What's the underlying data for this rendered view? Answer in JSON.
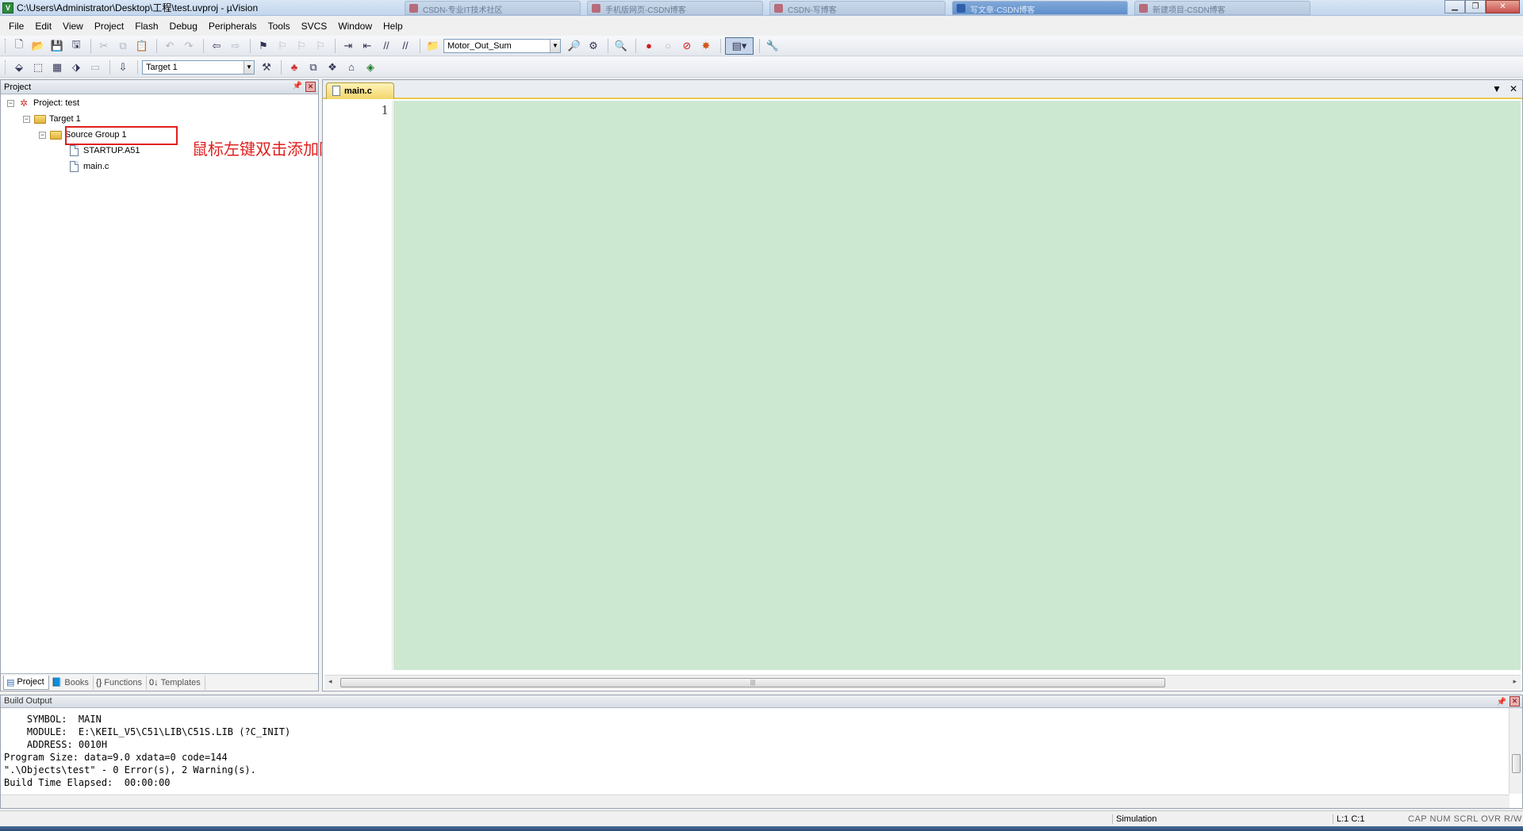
{
  "window": {
    "title": "C:\\Users\\Administrator\\Desktop\\工程\\test.uvproj - µVision",
    "background_tabs": [
      "CSDN-专业IT技术社区",
      "手机版网页-CSDN博客",
      "CSDN-写博客",
      "写文章-CSDN博客",
      "新建项目-CSDN博客"
    ]
  },
  "menu": [
    "File",
    "Edit",
    "View",
    "Project",
    "Flash",
    "Debug",
    "Peripherals",
    "Tools",
    "SVCS",
    "Window",
    "Help"
  ],
  "toolbar": {
    "function_combo": "Motor_Out_Sum",
    "target_combo": "Target 1"
  },
  "project_panel": {
    "title": "Project",
    "tree": {
      "project": "Project: test",
      "target": "Target 1",
      "group": "Source Group 1",
      "files": [
        "STARTUP.A51",
        "main.c"
      ]
    },
    "annotation": "鼠标左键双击添加刚新建的main.c",
    "tabs": [
      "Project",
      "Books",
      "Functions",
      "Templates"
    ]
  },
  "editor": {
    "tab": "main.c",
    "line_numbers": [
      "1"
    ],
    "code_bg": "#cde8d0"
  },
  "build_output": {
    "title": "Build Output",
    "lines": [
      "    SYMBOL:  MAIN",
      "    MODULE:  E:\\KEIL_V5\\C51\\LIB\\C51S.LIB (?C_INIT)",
      "    ADDRESS: 0010H",
      "Program Size: data=9.0 xdata=0 code=144",
      "\".\\Objects\\test\" - 0 Error(s), 2 Warning(s).",
      "Build Time Elapsed:  00:00:00"
    ]
  },
  "status": {
    "mode": "Simulation",
    "position": "L:1 C:1",
    "keys": "CAP  NUM  SCRL  OVR  R/W"
  },
  "colors": {
    "annotation_red": "#e0201f",
    "tab_yellow": "#f2d56a",
    "editor_green": "#cde8d0"
  }
}
